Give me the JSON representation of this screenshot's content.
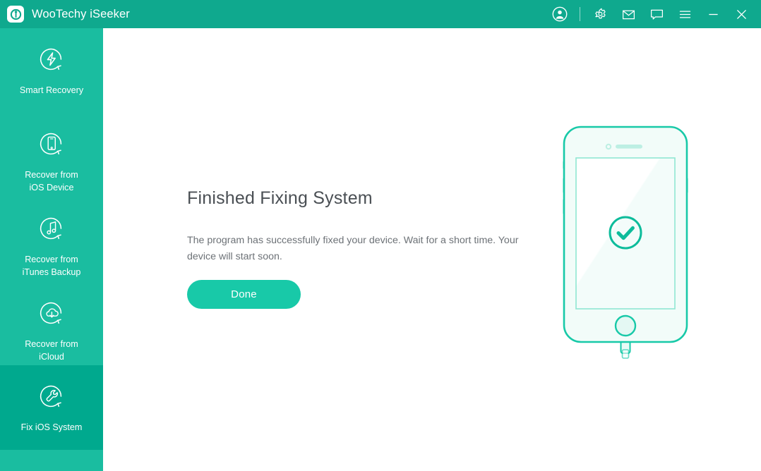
{
  "window": {
    "app_title": "WooTechy iSeeker",
    "logo_icon": "wootechy-logo-icon",
    "accent_color": "#0FA98E",
    "sidebar_color": "#1ABDA0",
    "sidebar_selected_color": "#00A98E",
    "button_color": "#18C9A8",
    "illustration_color": "#18C9A8"
  },
  "titlebar_buttons": [
    {
      "name": "account-icon",
      "label": "Account"
    },
    {
      "name": "gear-icon",
      "label": "Settings"
    },
    {
      "name": "mail-icon",
      "label": "Feedback Mail"
    },
    {
      "name": "chat-icon",
      "label": "Support Chat"
    },
    {
      "name": "menu-icon",
      "label": "Menu"
    },
    {
      "name": "minimize-icon",
      "label": "Minimize"
    },
    {
      "name": "close-icon",
      "label": "Close"
    }
  ],
  "sidebar": {
    "items": [
      {
        "id": "smart-recovery",
        "label": "Smart Recovery",
        "icon": "lightning-refresh-icon",
        "selected": false
      },
      {
        "id": "recover-ios-device",
        "label": "Recover from\niOS Device",
        "icon": "phone-refresh-icon",
        "selected": false
      },
      {
        "id": "recover-itunes-backup",
        "label": "Recover from\niTunes Backup",
        "icon": "music-refresh-icon",
        "selected": false
      },
      {
        "id": "recover-icloud",
        "label": "Recover from\niCloud",
        "icon": "cloud-download-refresh-icon",
        "selected": false
      },
      {
        "id": "fix-ios-system",
        "label": "Fix iOS System",
        "icon": "wrench-refresh-icon",
        "selected": true
      }
    ]
  },
  "main": {
    "heading": "Finished Fixing System",
    "description": "The program has successfully fixed your device. Wait for a short time. Your device will start soon.",
    "done_label": "Done",
    "illustration": {
      "name": "iphone-success-illustration",
      "status_icon": "check-circle-icon"
    }
  }
}
